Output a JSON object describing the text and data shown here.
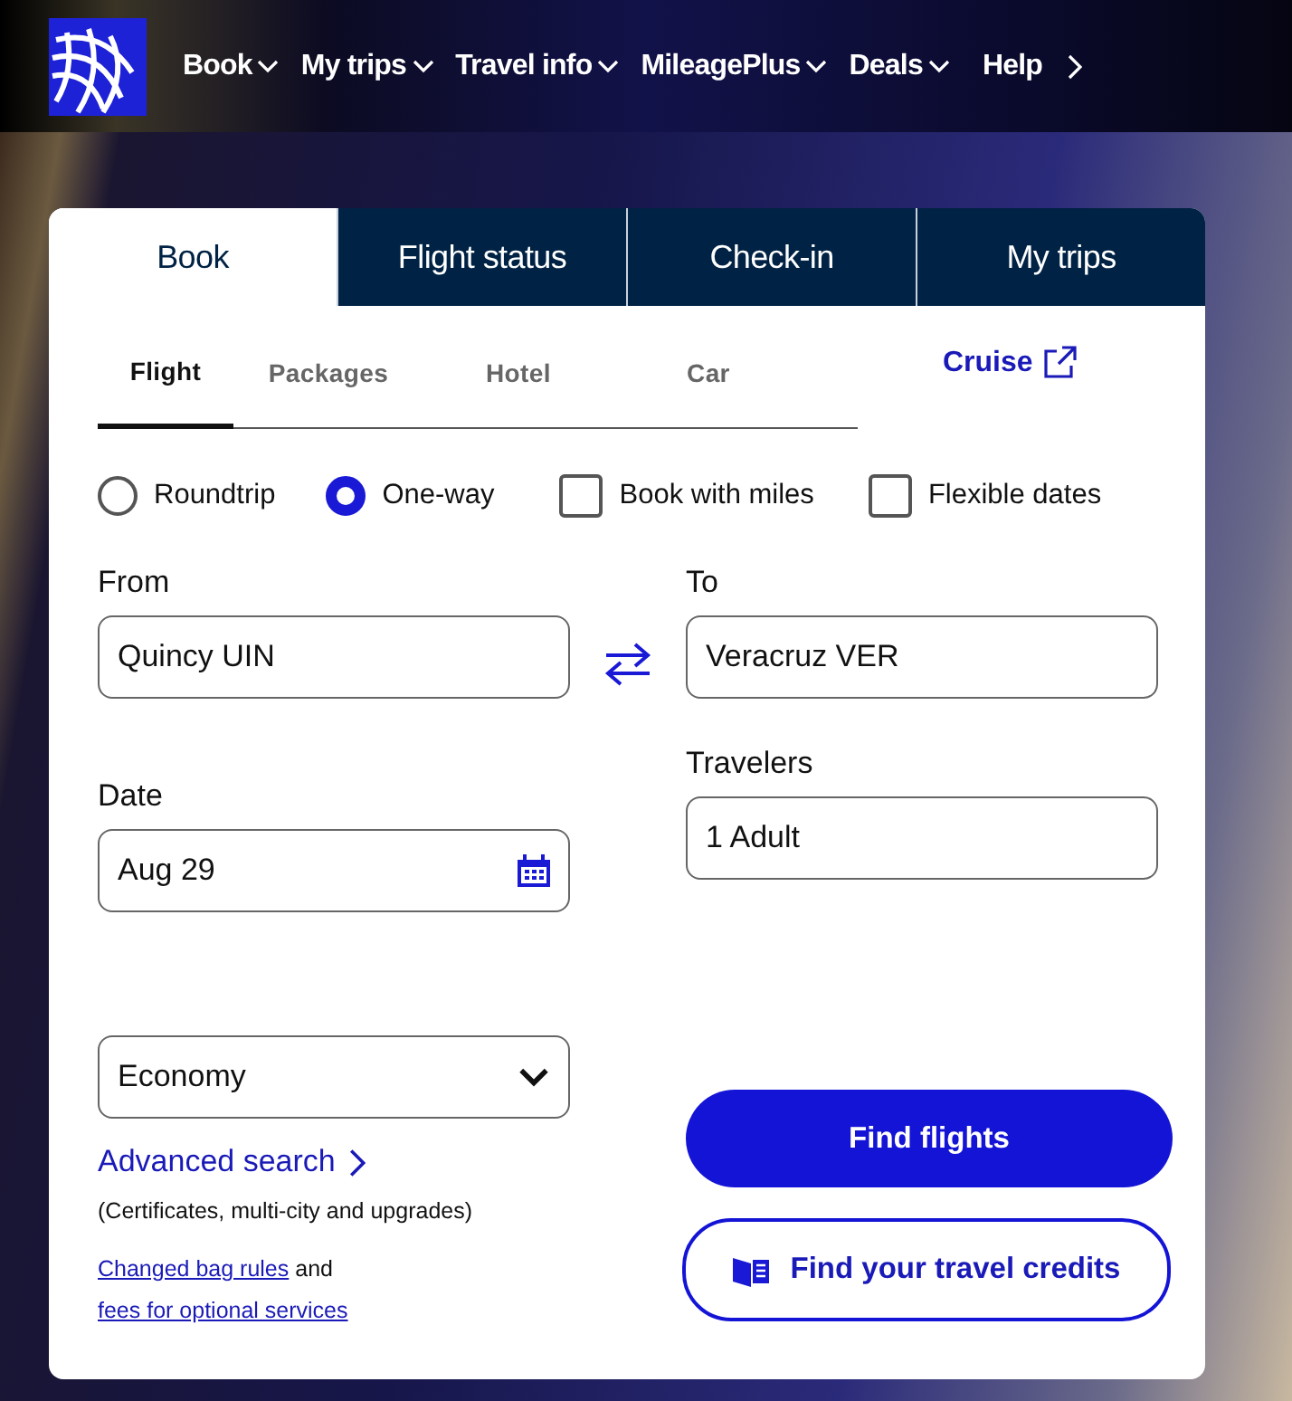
{
  "nav": {
    "items": [
      {
        "label": "Book",
        "kind": "dropdown"
      },
      {
        "label": "My trips",
        "kind": "dropdown"
      },
      {
        "label": "Travel info",
        "kind": "dropdown"
      },
      {
        "label": "MileagePlus",
        "kind": "dropdown"
      },
      {
        "label": "Deals",
        "kind": "dropdown"
      },
      {
        "label": "Help",
        "kind": "link"
      }
    ]
  },
  "main_tabs": [
    {
      "label": "Book",
      "selected": true
    },
    {
      "label": "Flight status",
      "selected": false
    },
    {
      "label": "Check-in",
      "selected": false
    },
    {
      "label": "My trips",
      "selected": false
    }
  ],
  "sub_tabs": [
    {
      "label": "Flight",
      "kind": "tab",
      "selected": true
    },
    {
      "label": "Packages",
      "kind": "tab",
      "selected": false
    },
    {
      "label": "Hotel",
      "kind": "tab",
      "selected": false
    },
    {
      "label": "Car",
      "kind": "tab",
      "selected": false
    },
    {
      "label": "Cruise",
      "kind": "external"
    }
  ],
  "trip_options": [
    {
      "label": "Roundtrip",
      "kind": "radio",
      "selected": false
    },
    {
      "label": "One-way",
      "kind": "radio",
      "selected": true
    },
    {
      "label": "Book with miles",
      "kind": "checkbox",
      "checked": false
    },
    {
      "label": "Flexible dates",
      "kind": "checkbox",
      "checked": false
    }
  ],
  "from": {
    "label": "From",
    "value": "Quincy UIN"
  },
  "to": {
    "label": "To",
    "value": "Veracruz VER"
  },
  "date": {
    "label": "Date",
    "value": "Aug 29"
  },
  "travelers": {
    "label": "Travelers",
    "value": "1 Adult"
  },
  "cabin": {
    "value": "Economy"
  },
  "advanced_search": {
    "label": "Advanced search",
    "note": "(Certificates, multi-city and upgrades)"
  },
  "bag_rules": {
    "link_1": "Changed bag rules",
    "connector": "and",
    "link_2": "fees for optional services"
  },
  "buttons": {
    "find_flights": "Find flights",
    "travel_credits": "Find your travel credits"
  }
}
